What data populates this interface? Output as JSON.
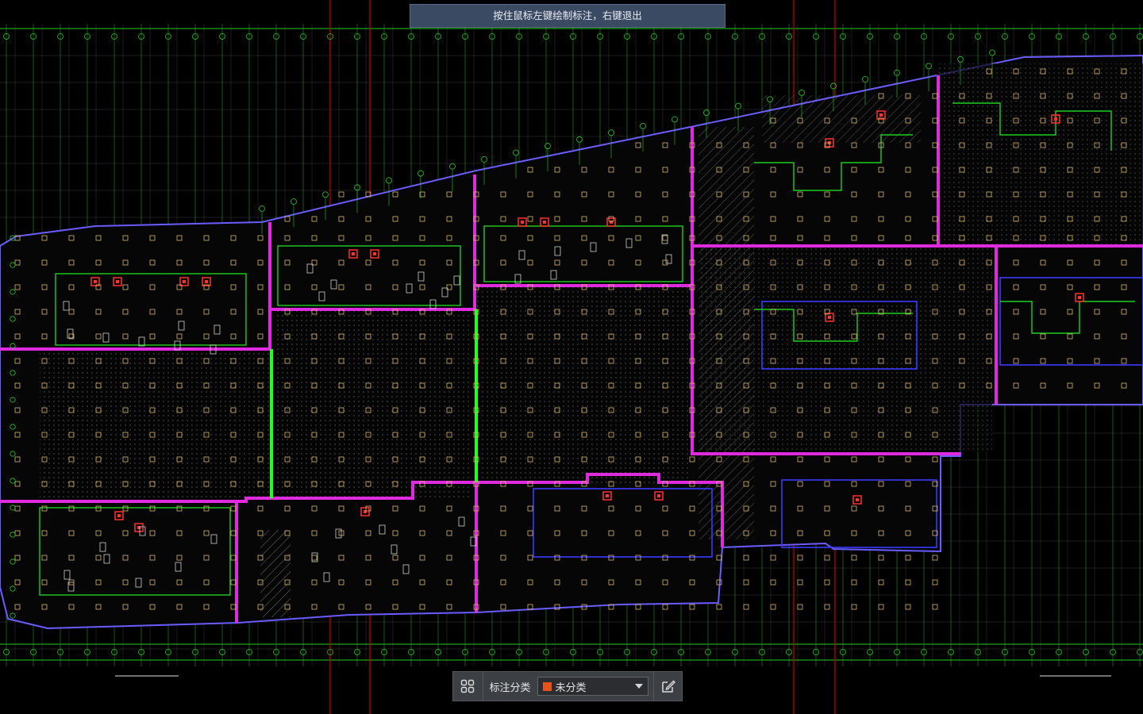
{
  "hint": {
    "text": "按住鼠标左键绘制标注，右键退出"
  },
  "toolbar": {
    "category_label": "标注分类",
    "category_value": "未分类",
    "category_color": "#e8531c"
  },
  "icons": {
    "grid": "apps-grid-icon",
    "edit": "edit-annotation-icon",
    "dropdown": "chevron-down-icon"
  },
  "colors": {
    "background": "#000000",
    "grid": "#22cc22",
    "wall": "#dd22dd",
    "axis": "#cc0000"
  }
}
